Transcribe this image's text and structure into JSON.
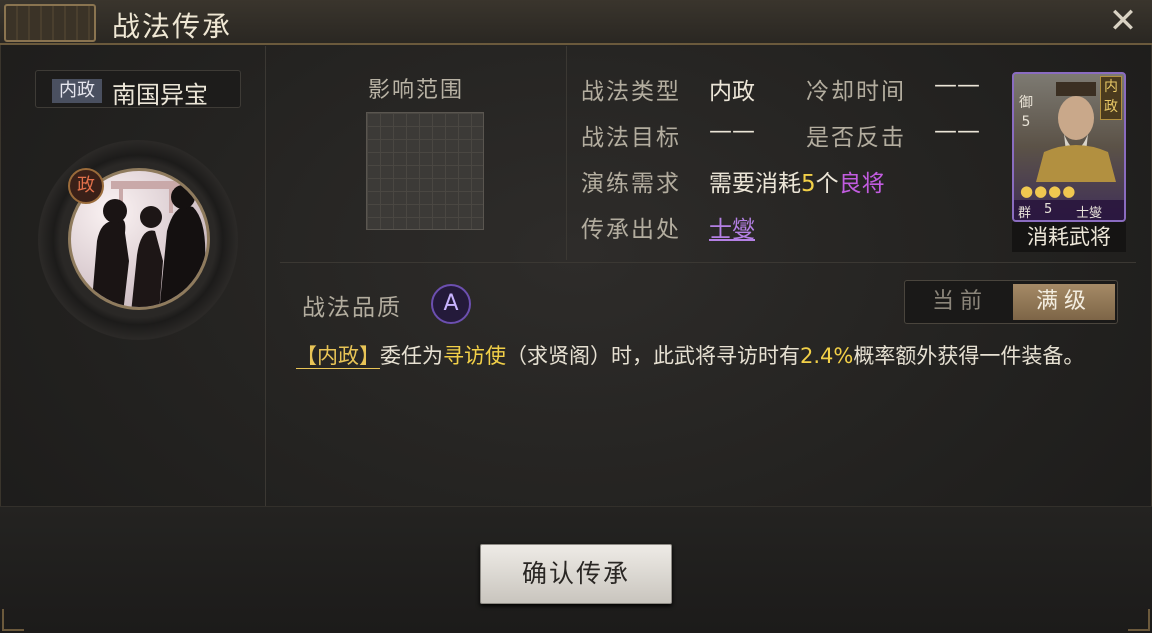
{
  "window": {
    "title": "战法传承",
    "close_icon": "close-icon"
  },
  "skill": {
    "tag": "内政",
    "name": "南国异宝",
    "emblem_badge": "政"
  },
  "range": {
    "label": "影响范围"
  },
  "info": {
    "type_label": "战法类型",
    "type_value": "内政",
    "cooldown_label": "冷却时间",
    "cooldown_value": "——",
    "target_label": "战法目标",
    "target_value": "——",
    "counter_label": "是否反击",
    "counter_value": "——",
    "train_label": "演练需求",
    "train_prefix": "需要消耗",
    "train_count": "5",
    "train_unit": "个",
    "train_quality": "良将",
    "source_label": "传承出处",
    "source_value": "士燮"
  },
  "card": {
    "type": "内政",
    "stat_label": "御",
    "stat_value": "5",
    "stars": "●●●●",
    "faction": "群",
    "cost": "5",
    "name": "士燮",
    "caption": "消耗武将"
  },
  "quality": {
    "label": "战法品质",
    "grade": "A"
  },
  "toggle": {
    "current": "当前",
    "max": "满级"
  },
  "description": {
    "tag": "【内政】",
    "part1": "委任为",
    "role": "寻访使",
    "part2": "（求贤阁）时，此武将寻访时有",
    "chance": "2.4%",
    "part3": "概率额外获得一件装备。"
  },
  "confirm": {
    "label": "确认传承"
  },
  "colors": {
    "gold": "#f2d048",
    "purple": "#c25ce0",
    "accent": "#8f7b5d"
  }
}
